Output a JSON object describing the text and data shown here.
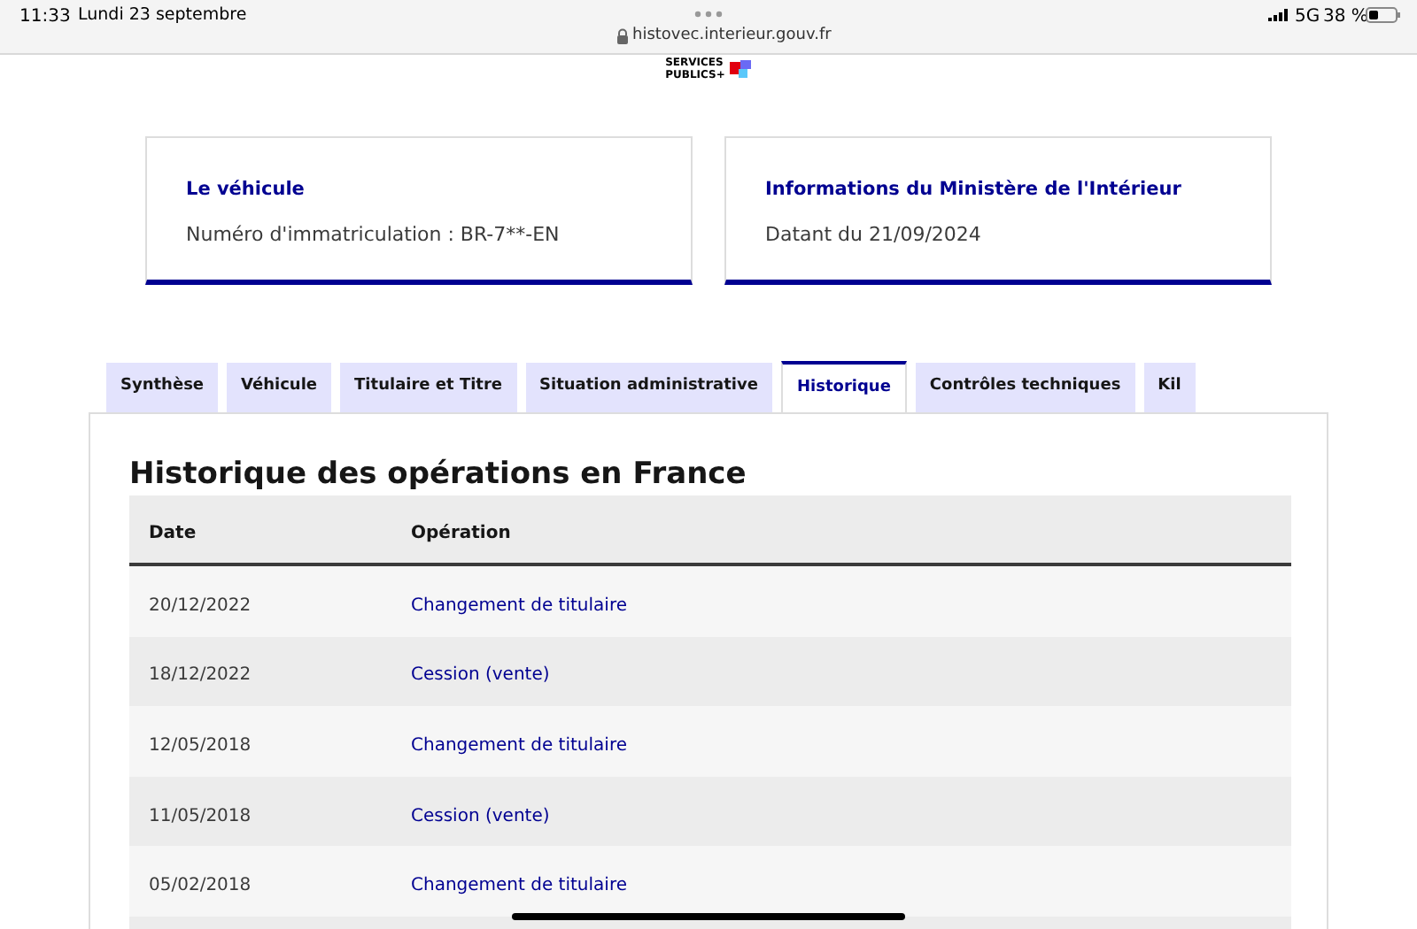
{
  "status_bar": {
    "time": "11:33",
    "date": "Lundi 23 septembre",
    "url": "histovec.interieur.gouv.fr",
    "network": "5G",
    "battery": "38 %"
  },
  "logo": {
    "line_1": "SERVICES",
    "line_2": "PUBLICS+"
  },
  "cards": [
    {
      "title": "Le véhicule",
      "text": "Numéro d'immatriculation : BR-7**-EN"
    },
    {
      "title": "Informations du Ministère de l'Intérieur",
      "text": "Datant du 21/09/2024"
    }
  ],
  "tabs": [
    {
      "label": "Synthèse",
      "selected": false
    },
    {
      "label": "Véhicule",
      "selected": false
    },
    {
      "label": "Titulaire et Titre",
      "selected": false
    },
    {
      "label": "Situation administrative",
      "selected": false
    },
    {
      "label": "Historique",
      "selected": true
    },
    {
      "label": "Contrôles techniques",
      "selected": false
    },
    {
      "label": "Kil",
      "selected": false
    }
  ],
  "section_title": "Historique des opérations en France",
  "table": {
    "columns": [
      "Date",
      "Opération"
    ],
    "rows": [
      [
        "20/12/2022",
        "Changement de titulaire"
      ],
      [
        "18/12/2022",
        "Cession (vente)"
      ],
      [
        "12/05/2018",
        "Changement de titulaire"
      ],
      [
        "11/05/2018",
        "Cession (vente)"
      ],
      [
        "05/02/2018",
        "Changement de titulaire"
      ]
    ]
  }
}
